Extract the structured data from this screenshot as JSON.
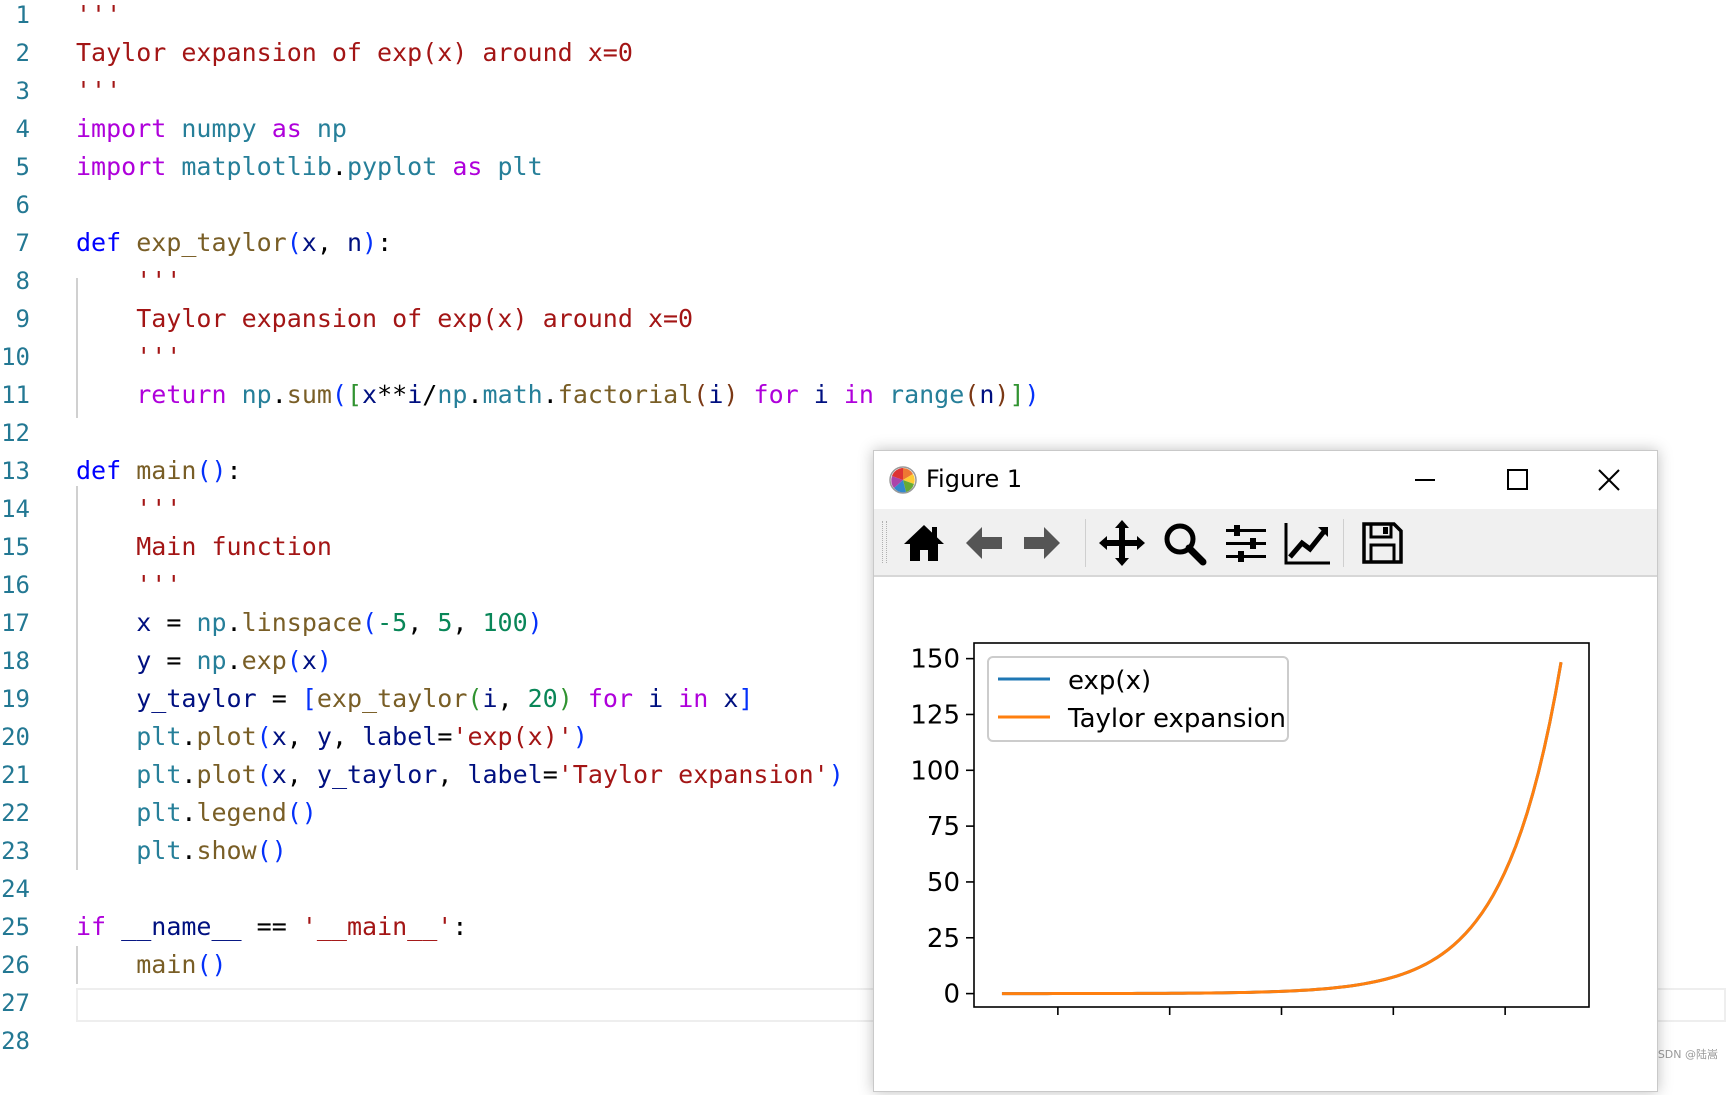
{
  "editor": {
    "line_numbers": [
      "1",
      "2",
      "3",
      "4",
      "5",
      "6",
      "7",
      "8",
      "9",
      "10",
      "11",
      "12",
      "13",
      "14",
      "15",
      "16",
      "17",
      "18",
      "19",
      "20",
      "21",
      "22",
      "23",
      "24",
      "25",
      "26",
      "27",
      "28"
    ],
    "lines": [
      [
        {
          "t": "'''",
          "c": "#a31515"
        }
      ],
      [
        {
          "t": "Taylor expansion of exp(x) around x=0",
          "c": "#a31515"
        }
      ],
      [
        {
          "t": "'''",
          "c": "#a31515"
        }
      ],
      [
        {
          "t": "import",
          "c": "#af00db"
        },
        {
          "t": " ",
          "c": "#000000"
        },
        {
          "t": "numpy",
          "c": "#267f99"
        },
        {
          "t": " ",
          "c": "#000000"
        },
        {
          "t": "as",
          "c": "#af00db"
        },
        {
          "t": " ",
          "c": "#000000"
        },
        {
          "t": "np",
          "c": "#267f99"
        }
      ],
      [
        {
          "t": "import",
          "c": "#af00db"
        },
        {
          "t": " ",
          "c": "#000000"
        },
        {
          "t": "matplotlib",
          "c": "#267f99"
        },
        {
          "t": ".",
          "c": "#000000"
        },
        {
          "t": "pyplot",
          "c": "#267f99"
        },
        {
          "t": " ",
          "c": "#000000"
        },
        {
          "t": "as",
          "c": "#af00db"
        },
        {
          "t": " ",
          "c": "#000000"
        },
        {
          "t": "plt",
          "c": "#267f99"
        }
      ],
      [],
      [
        {
          "t": "def",
          "c": "#0000ff"
        },
        {
          "t": " ",
          "c": "#000000"
        },
        {
          "t": "exp_taylor",
          "c": "#795e26"
        },
        {
          "t": "(",
          "c": "#0431fa"
        },
        {
          "t": "x",
          "c": "#001080"
        },
        {
          "t": ", ",
          "c": "#000000"
        },
        {
          "t": "n",
          "c": "#001080"
        },
        {
          "t": ")",
          "c": "#0431fa"
        },
        {
          "t": ":",
          "c": "#000000"
        }
      ],
      [
        {
          "t": "    '''",
          "c": "#a31515"
        }
      ],
      [
        {
          "t": "    Taylor expansion of exp(x) around x=0",
          "c": "#a31515"
        }
      ],
      [
        {
          "t": "    '''",
          "c": "#a31515"
        }
      ],
      [
        {
          "t": "    ",
          "c": "#000000"
        },
        {
          "t": "return",
          "c": "#af00db"
        },
        {
          "t": " ",
          "c": "#000000"
        },
        {
          "t": "np",
          "c": "#267f99"
        },
        {
          "t": ".",
          "c": "#000000"
        },
        {
          "t": "sum",
          "c": "#795e26"
        },
        {
          "t": "(",
          "c": "#0431fa"
        },
        {
          "t": "[",
          "c": "#319331"
        },
        {
          "t": "x",
          "c": "#001080"
        },
        {
          "t": "**",
          "c": "#000000"
        },
        {
          "t": "i",
          "c": "#001080"
        },
        {
          "t": "/",
          "c": "#000000"
        },
        {
          "t": "np",
          "c": "#267f99"
        },
        {
          "t": ".",
          "c": "#000000"
        },
        {
          "t": "math",
          "c": "#267f99"
        },
        {
          "t": ".",
          "c": "#000000"
        },
        {
          "t": "factorial",
          "c": "#795e26"
        },
        {
          "t": "(",
          "c": "#7b3814"
        },
        {
          "t": "i",
          "c": "#001080"
        },
        {
          "t": ")",
          "c": "#7b3814"
        },
        {
          "t": " ",
          "c": "#000000"
        },
        {
          "t": "for",
          "c": "#af00db"
        },
        {
          "t": " ",
          "c": "#000000"
        },
        {
          "t": "i",
          "c": "#001080"
        },
        {
          "t": " ",
          "c": "#000000"
        },
        {
          "t": "in",
          "c": "#af00db"
        },
        {
          "t": " ",
          "c": "#000000"
        },
        {
          "t": "range",
          "c": "#267f99"
        },
        {
          "t": "(",
          "c": "#7b3814"
        },
        {
          "t": "n",
          "c": "#001080"
        },
        {
          "t": ")",
          "c": "#7b3814"
        },
        {
          "t": "]",
          "c": "#319331"
        },
        {
          "t": ")",
          "c": "#0431fa"
        }
      ],
      [],
      [
        {
          "t": "def",
          "c": "#0000ff"
        },
        {
          "t": " ",
          "c": "#000000"
        },
        {
          "t": "main",
          "c": "#795e26"
        },
        {
          "t": "()",
          "c": "#0431fa"
        },
        {
          "t": ":",
          "c": "#000000"
        }
      ],
      [
        {
          "t": "    '''",
          "c": "#a31515"
        }
      ],
      [
        {
          "t": "    Main function",
          "c": "#a31515"
        }
      ],
      [
        {
          "t": "    '''",
          "c": "#a31515"
        }
      ],
      [
        {
          "t": "    ",
          "c": "#000000"
        },
        {
          "t": "x",
          "c": "#001080"
        },
        {
          "t": " = ",
          "c": "#000000"
        },
        {
          "t": "np",
          "c": "#267f99"
        },
        {
          "t": ".",
          "c": "#000000"
        },
        {
          "t": "linspace",
          "c": "#795e26"
        },
        {
          "t": "(",
          "c": "#0431fa"
        },
        {
          "t": "-5",
          "c": "#098658"
        },
        {
          "t": ", ",
          "c": "#000000"
        },
        {
          "t": "5",
          "c": "#098658"
        },
        {
          "t": ", ",
          "c": "#000000"
        },
        {
          "t": "100",
          "c": "#098658"
        },
        {
          "t": ")",
          "c": "#0431fa"
        }
      ],
      [
        {
          "t": "    ",
          "c": "#000000"
        },
        {
          "t": "y",
          "c": "#001080"
        },
        {
          "t": " = ",
          "c": "#000000"
        },
        {
          "t": "np",
          "c": "#267f99"
        },
        {
          "t": ".",
          "c": "#000000"
        },
        {
          "t": "exp",
          "c": "#795e26"
        },
        {
          "t": "(",
          "c": "#0431fa"
        },
        {
          "t": "x",
          "c": "#001080"
        },
        {
          "t": ")",
          "c": "#0431fa"
        }
      ],
      [
        {
          "t": "    ",
          "c": "#000000"
        },
        {
          "t": "y_taylor",
          "c": "#001080"
        },
        {
          "t": " = ",
          "c": "#000000"
        },
        {
          "t": "[",
          "c": "#0431fa"
        },
        {
          "t": "exp_taylor",
          "c": "#795e26"
        },
        {
          "t": "(",
          "c": "#319331"
        },
        {
          "t": "i",
          "c": "#001080"
        },
        {
          "t": ", ",
          "c": "#000000"
        },
        {
          "t": "20",
          "c": "#098658"
        },
        {
          "t": ")",
          "c": "#319331"
        },
        {
          "t": " ",
          "c": "#000000"
        },
        {
          "t": "for",
          "c": "#af00db"
        },
        {
          "t": " ",
          "c": "#000000"
        },
        {
          "t": "i",
          "c": "#001080"
        },
        {
          "t": " ",
          "c": "#000000"
        },
        {
          "t": "in",
          "c": "#af00db"
        },
        {
          "t": " ",
          "c": "#000000"
        },
        {
          "t": "x",
          "c": "#001080"
        },
        {
          "t": "]",
          "c": "#0431fa"
        }
      ],
      [
        {
          "t": "    ",
          "c": "#000000"
        },
        {
          "t": "plt",
          "c": "#267f99"
        },
        {
          "t": ".",
          "c": "#000000"
        },
        {
          "t": "plot",
          "c": "#795e26"
        },
        {
          "t": "(",
          "c": "#0431fa"
        },
        {
          "t": "x",
          "c": "#001080"
        },
        {
          "t": ", ",
          "c": "#000000"
        },
        {
          "t": "y",
          "c": "#001080"
        },
        {
          "t": ", ",
          "c": "#000000"
        },
        {
          "t": "label",
          "c": "#001080"
        },
        {
          "t": "=",
          "c": "#000000"
        },
        {
          "t": "'exp(x)'",
          "c": "#a31515"
        },
        {
          "t": ")",
          "c": "#0431fa"
        }
      ],
      [
        {
          "t": "    ",
          "c": "#000000"
        },
        {
          "t": "plt",
          "c": "#267f99"
        },
        {
          "t": ".",
          "c": "#000000"
        },
        {
          "t": "plot",
          "c": "#795e26"
        },
        {
          "t": "(",
          "c": "#0431fa"
        },
        {
          "t": "x",
          "c": "#001080"
        },
        {
          "t": ", ",
          "c": "#000000"
        },
        {
          "t": "y_taylor",
          "c": "#001080"
        },
        {
          "t": ", ",
          "c": "#000000"
        },
        {
          "t": "label",
          "c": "#001080"
        },
        {
          "t": "=",
          "c": "#000000"
        },
        {
          "t": "'Taylor expansion'",
          "c": "#a31515"
        },
        {
          "t": ")",
          "c": "#0431fa"
        }
      ],
      [
        {
          "t": "    ",
          "c": "#000000"
        },
        {
          "t": "plt",
          "c": "#267f99"
        },
        {
          "t": ".",
          "c": "#000000"
        },
        {
          "t": "legend",
          "c": "#795e26"
        },
        {
          "t": "()",
          "c": "#0431fa"
        }
      ],
      [
        {
          "t": "    ",
          "c": "#000000"
        },
        {
          "t": "plt",
          "c": "#267f99"
        },
        {
          "t": ".",
          "c": "#000000"
        },
        {
          "t": "show",
          "c": "#795e26"
        },
        {
          "t": "()",
          "c": "#0431fa"
        }
      ],
      [],
      [
        {
          "t": "if",
          "c": "#af00db"
        },
        {
          "t": " ",
          "c": "#000000"
        },
        {
          "t": "__name__",
          "c": "#001080"
        },
        {
          "t": " == ",
          "c": "#000000"
        },
        {
          "t": "'__main__'",
          "c": "#a31515"
        },
        {
          "t": ":",
          "c": "#000000"
        }
      ],
      [
        {
          "t": "    ",
          "c": "#000000"
        },
        {
          "t": "main",
          "c": "#795e26"
        },
        {
          "t": "()",
          "c": "#0431fa"
        }
      ],
      [],
      []
    ]
  },
  "watermark": "CSDN @陆嵩",
  "figure_window": {
    "title": "Figure 1",
    "icons": {
      "app": "matplotlib-logo-icon",
      "minimize": "minimize-icon",
      "maximize": "maximize-icon",
      "close": "close-icon"
    },
    "toolbar": [
      "home-icon",
      "back-arrow-icon",
      "forward-arrow-icon",
      "pan-icon",
      "zoom-icon",
      "configure-subplots-icon",
      "edit-axis-icon",
      "save-icon"
    ]
  },
  "chart_data": {
    "type": "line",
    "x_range": [
      -5,
      5
    ],
    "ylim": [
      -6,
      157
    ],
    "yticks": [
      0,
      25,
      50,
      75,
      100,
      125,
      150
    ],
    "ytick_labels": [
      "0",
      "25",
      "50",
      "75",
      "100",
      "125",
      "150"
    ],
    "xticks_count": 5,
    "legend": [
      "exp(x)",
      "Taylor expansion"
    ],
    "legend_position": "upper left",
    "series": [
      {
        "name": "exp(x)",
        "color": "#1f77b4",
        "function": "exp(x)",
        "samples": 100
      },
      {
        "name": "Taylor expansion",
        "color": "#ff7f0e",
        "function": "exp(x)",
        "samples": 100
      }
    ]
  }
}
